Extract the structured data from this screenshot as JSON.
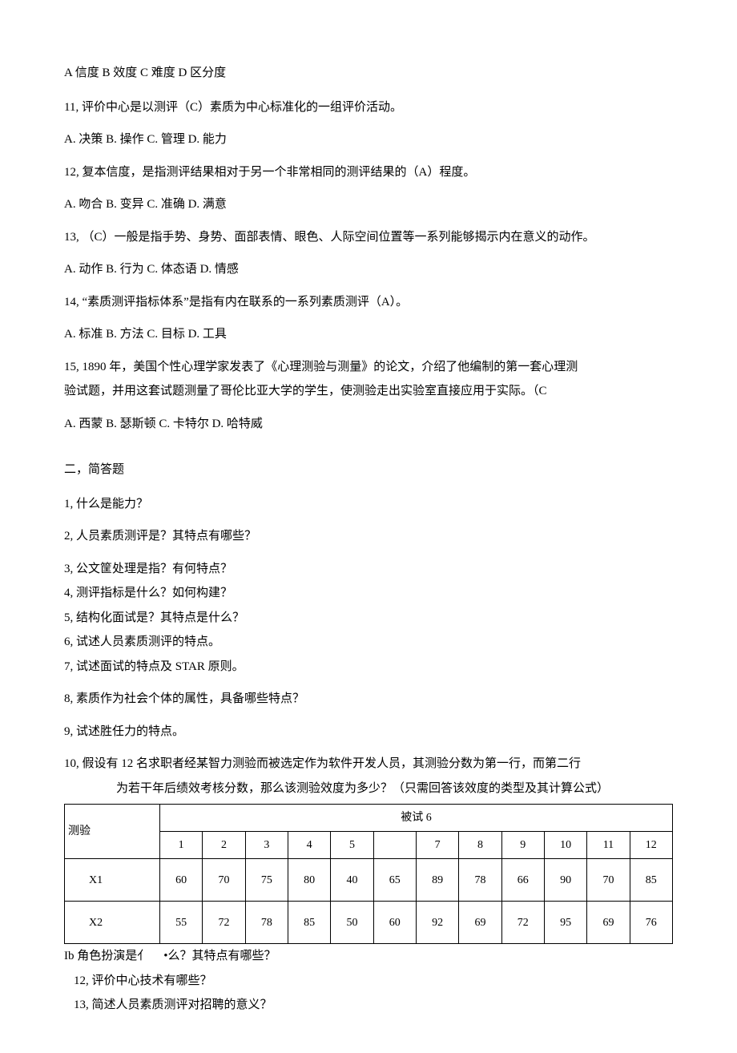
{
  "q10_options": "A 信度 B 效度                          C 难度 D 区分度",
  "q11_stem": "11, 评价中心是以测评（C）素质为中心标准化的一组评价活动。",
  "q11_options": "A. 决策 B. 操作 C. 管理 D. 能力",
  "q12_stem": "12, 复本信度，是指测评结果相对于另一个非常相同的测评结果的（A）程度。",
  "q12_options": "A. 吻合 B. 变异 C. 准确 D. 满意",
  "q13_stem": "13, （C）一般是指手势、身势、面部表情、眼色、人际空间位置等一系列能够揭示内在意义的动作。",
  "q13_options": "A. 动作 B. 行为 C. 体态语 D. 情感",
  "q14_stem": "14, “素质测评指标体系”是指有内在联系的一系列素质测评（A）。",
  "q14_options": "A. 标准 B. 方法 C. 目标 D. 工具",
  "q15_line1": "15,  1890 年，美国个性心理学家发表了《心理测验与测量》的论文，介绍了他编制的第一套心理测",
  "q15_line2": "验试题，并用这套试题测量了哥伦比亚大学的学生，使测验走出实验室直接应用于实际。（C",
  "q15_options": "A. 西蒙 B. 瑟斯顿 C. 卡特尔 D. 哈特威",
  "section2_title": "二，简答题",
  "s2_q1": "1, 什么是能力？",
  "s2_q2": "2, 人员素质测评是？其特点有哪些？",
  "s2_q3": "3, 公文筐处理是指？有何特点？",
  "s2_q4": "4, 测评指标是什么？如何构建？",
  "s2_q5": "5, 结构化面试是？其特点是什么？",
  "s2_q6": "6, 试述人员素质测评的特点。",
  "s2_q7": "7, 试述面试的特点及 STAR 原则。",
  "s2_q8": "8, 素质作为社会个体的属性，具备哪些特点？",
  "s2_q9": "9, 试述胜任力的特点。",
  "s2_q10_line1": "10, 假设有 12 名求职者经某智力测验而被选定作为软件开发人员，其测验分数为第一行，而第二行",
  "s2_q10_line2": "为若干年后绩效考核分数，那么该测验效度为多少？（只需回答该效度的类型及其计算公式）",
  "chart_data": {
    "type": "table",
    "row_header_label": "测验",
    "group_header_label": "被试 6",
    "col_numbers": [
      "1",
      "2",
      "3",
      "4",
      "5",
      "",
      "7",
      "8",
      "9",
      "10",
      "11",
      "12"
    ],
    "rows": [
      {
        "name": "X1",
        "values": [
          "60",
          "70",
          "75",
          "80",
          "40",
          "65",
          "89",
          "78",
          "66",
          "90",
          "70",
          "85"
        ]
      },
      {
        "name": "X2",
        "values": [
          "55",
          "72",
          "78",
          "85",
          "50",
          "60",
          "92",
          "69",
          "72",
          "95",
          "69",
          "76"
        ]
      }
    ]
  },
  "after_table_line1_a": "Ib 角色扮演是亻",
  "after_table_line1_b": "•么？其特点有哪些？",
  "after_table_line2": "12, 评价中心技术有哪些？",
  "after_table_line3": "13, 简述人员素质测评对招聘的意义？"
}
